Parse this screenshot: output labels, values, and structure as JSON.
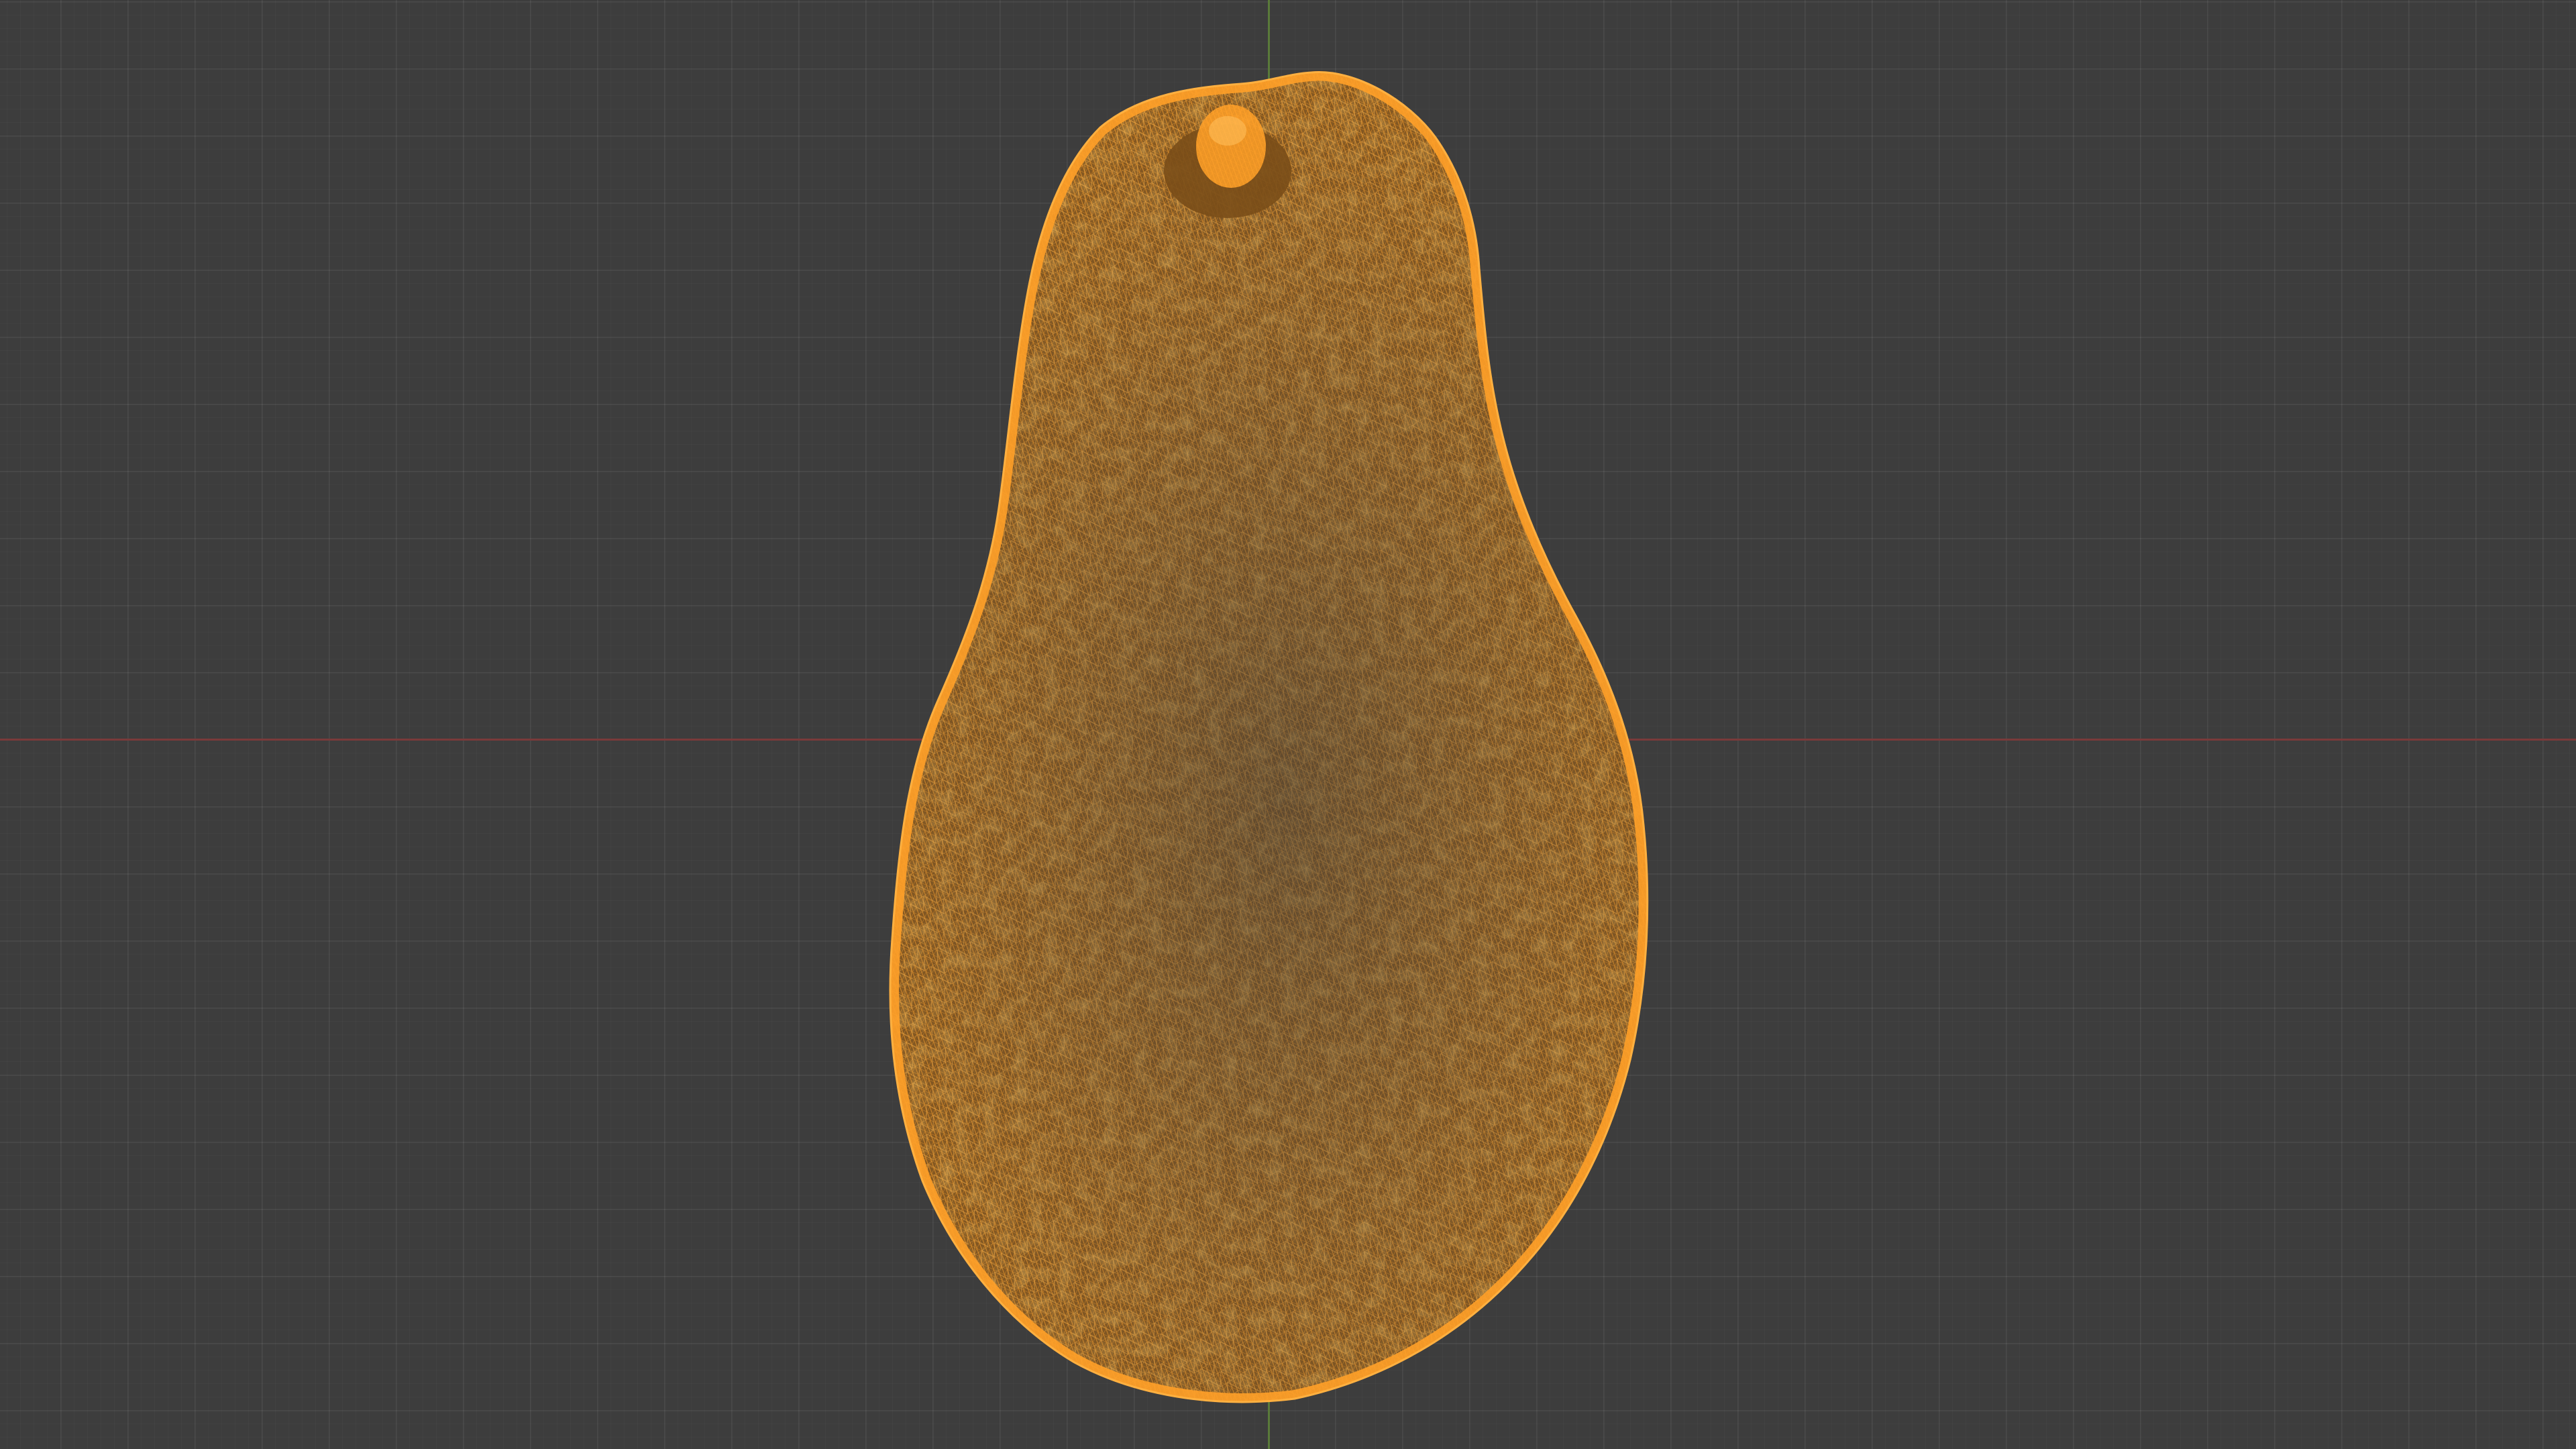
{
  "viewport": {
    "background_color": "#3d3d3d",
    "grid_line_color": "#474747",
    "x_axis_color": "#7a3a3a",
    "y_axis_color": "#5a7a3a"
  },
  "object": {
    "type": "wireframe-mesh",
    "shape": "avocado",
    "selected": true,
    "wire_color": "#ffa028",
    "wire_dark_color": "#a05f14"
  }
}
